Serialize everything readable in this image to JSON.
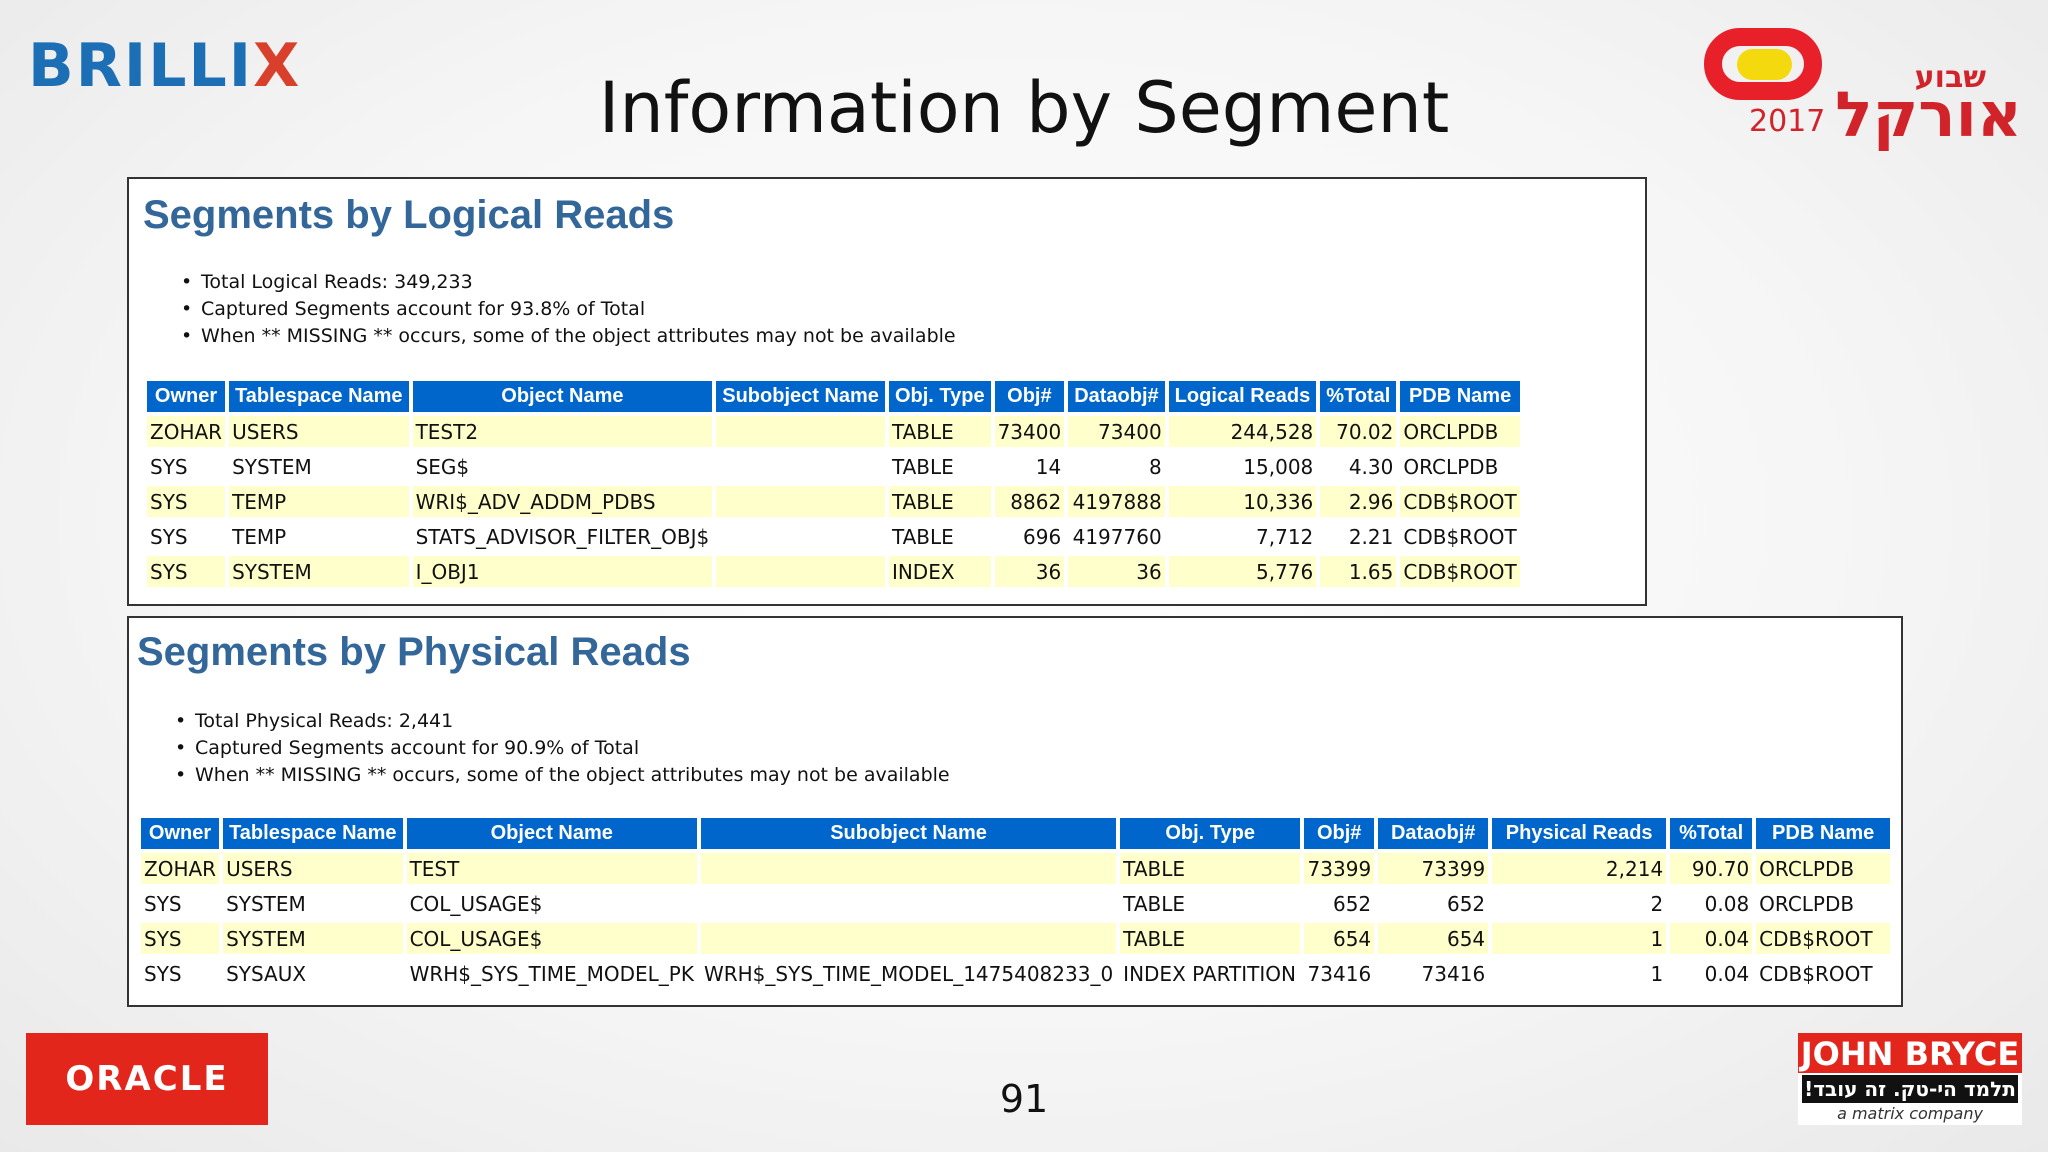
{
  "header": {
    "brillix_logo_main": "BRILLI",
    "brillix_logo_x": "X",
    "title": "Information by Segment",
    "event_logo_year": "2017",
    "event_logo_heb_small": "שבוע",
    "event_logo_heb_big": "אורקל"
  },
  "logical": {
    "heading": "Segments by Logical Reads",
    "bullets": [
      "Total Logical Reads: 349,233",
      "Captured Segments account for 93.8% of Total",
      "When ** MISSING ** occurs, some of the object attributes may not be available"
    ],
    "columns": [
      "Owner",
      "Tablespace Name",
      "Object Name",
      "Subobject Name",
      "Obj. Type",
      "Obj#",
      "Dataobj#",
      "Logical Reads",
      "%Total",
      "PDB Name"
    ],
    "rows": [
      [
        "ZOHAR",
        "USERS",
        "TEST2",
        "",
        "TABLE",
        "73400",
        "73400",
        "244,528",
        "70.02",
        "ORCLPDB"
      ],
      [
        "SYS",
        "SYSTEM",
        "SEG$",
        "",
        "TABLE",
        "14",
        "8",
        "15,008",
        "4.30",
        "ORCLPDB"
      ],
      [
        "SYS",
        "TEMP",
        "WRI$_ADV_ADDM_PDBS",
        "",
        "TABLE",
        "8862",
        "4197888",
        "10,336",
        "2.96",
        "CDB$ROOT"
      ],
      [
        "SYS",
        "TEMP",
        "STATS_ADVISOR_FILTER_OBJ$",
        "",
        "TABLE",
        "696",
        "4197760",
        "7,712",
        "2.21",
        "CDB$ROOT"
      ],
      [
        "SYS",
        "SYSTEM",
        "I_OBJ1",
        "",
        "INDEX",
        "36",
        "36",
        "5,776",
        "1.65",
        "CDB$ROOT"
      ]
    ]
  },
  "physical": {
    "heading": "Segments by Physical Reads",
    "bullets": [
      "Total Physical Reads: 2,441",
      "Captured Segments account for 90.9% of Total",
      "When ** MISSING ** occurs, some of the object attributes may not be available"
    ],
    "columns": [
      "Owner",
      "Tablespace Name",
      "Object Name",
      "Subobject Name",
      "Obj. Type",
      "Obj#",
      "Dataobj#",
      "Physical Reads",
      "%Total",
      "PDB Name"
    ],
    "rows": [
      [
        "ZOHAR",
        "USERS",
        "TEST",
        "",
        "TABLE",
        "73399",
        "73399",
        "2,214",
        "90.70",
        "ORCLPDB"
      ],
      [
        "SYS",
        "SYSTEM",
        "COL_USAGE$",
        "",
        "TABLE",
        "652",
        "652",
        "2",
        "0.08",
        "ORCLPDB"
      ],
      [
        "SYS",
        "SYSTEM",
        "COL_USAGE$",
        "",
        "TABLE",
        "654",
        "654",
        "1",
        "0.04",
        "CDB$ROOT"
      ],
      [
        "SYS",
        "SYSAUX",
        "WRH$_SYS_TIME_MODEL_PK",
        "WRH$_SYS_TIME_MODEL_1475408233_0",
        "INDEX PARTITION",
        "73416",
        "73416",
        "1",
        "0.04",
        "CDB$ROOT"
      ]
    ]
  },
  "footer": {
    "oracle_logo": "ORACLE",
    "page_number": "91",
    "jb_name": "JOHN BRYCE",
    "jb_heb": "תלמד הי-טק. זה עובד!",
    "jb_tagline": "a matrix company"
  }
}
